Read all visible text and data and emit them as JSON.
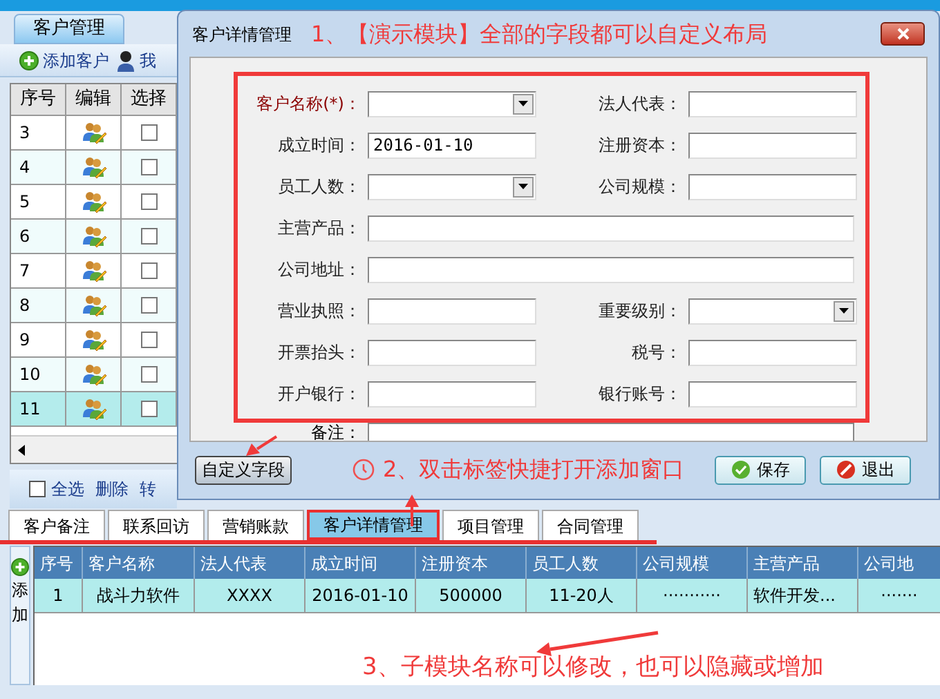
{
  "main_tab": {
    "label": "客户管理",
    "selected": true
  },
  "toolbar": [
    {
      "label": "添加客户",
      "kind": "add"
    },
    {
      "label": "我",
      "kind": "user"
    }
  ],
  "customer_grid": {
    "columns": [
      "序号",
      "编辑",
      "选择"
    ],
    "rows": [
      {
        "index": "3",
        "checked": false,
        "selected": false
      },
      {
        "index": "4",
        "checked": false,
        "selected": false
      },
      {
        "index": "5",
        "checked": false,
        "selected": false
      },
      {
        "index": "6",
        "checked": false,
        "selected": false
      },
      {
        "index": "7",
        "checked": false,
        "selected": false
      },
      {
        "index": "8",
        "checked": false,
        "selected": false
      },
      {
        "index": "9",
        "checked": false,
        "selected": false
      },
      {
        "index": "10",
        "checked": false,
        "selected": false
      },
      {
        "index": "11",
        "checked": false,
        "selected": true
      }
    ]
  },
  "bottom_actions": {
    "select_all": {
      "label": "全选",
      "checked": false
    },
    "links": [
      "删除",
      "转"
    ]
  },
  "dialog": {
    "title": "客户详情管理",
    "title_note": "1、【演示模块】全部的字段都可以自定义布局",
    "rows": [
      [
        {
          "label": "客户名称(*)：",
          "kind": "dropdown",
          "required": true
        },
        {
          "label": "法人代表：",
          "kind": "text",
          "required": false
        }
      ],
      [
        {
          "label": "成立时间：",
          "kind": "text",
          "required": false,
          "value": "2016-01-10"
        },
        {
          "label": "注册资本：",
          "kind": "text",
          "required": false
        }
      ],
      [
        {
          "label": "员工人数：",
          "kind": "dropdown",
          "required": false
        },
        {
          "label": "公司规模：",
          "kind": "text",
          "required": false
        }
      ],
      [
        {
          "label": "主营产品：",
          "kind": "text",
          "required": false
        }
      ],
      [
        {
          "label": "公司地址：",
          "kind": "text",
          "required": false
        }
      ],
      [
        {
          "label": "营业执照：",
          "kind": "text",
          "required": false
        },
        {
          "label": "重要级别：",
          "kind": "dropdown",
          "required": false
        }
      ],
      [
        {
          "label": "开票抬头：",
          "kind": "text",
          "required": false
        },
        {
          "label": "税号：",
          "kind": "text",
          "required": false
        }
      ],
      [
        {
          "label": "开户银行：",
          "kind": "text",
          "required": false
        },
        {
          "label": "银行账号：",
          "kind": "text",
          "required": false
        }
      ]
    ],
    "remark": {
      "label": "备注："
    },
    "custom_fields_button": "自定义字段",
    "footer_note": "2、双击标签快捷打开添加窗口",
    "buttons": [
      {
        "label": "保存",
        "kind": "save"
      },
      {
        "label": "退出",
        "kind": "exit"
      }
    ]
  },
  "sub_tabs": [
    {
      "label": "客户备注",
      "selected": false
    },
    {
      "label": "联系回访",
      "selected": false
    },
    {
      "label": "营销账款",
      "selected": false
    },
    {
      "label": "客户详情管理",
      "selected": true
    },
    {
      "label": "项目管理",
      "selected": false
    },
    {
      "label": "合同管理",
      "selected": false
    }
  ],
  "add_button": "添加",
  "detail_table": {
    "columns": [
      "序号",
      "客户名称",
      "法人代表",
      "成立时间",
      "注册资本",
      "员工人数",
      "公司规模",
      "主营产品",
      "公司地"
    ],
    "rows": [
      [
        "1",
        "战斗力软件",
        "XXXX",
        "2016-01-10",
        "500000",
        "11-20人",
        "···········",
        "软件开发...",
        "·······"
      ]
    ],
    "note": "3、子模块名称可以修改，也可以隐藏或增加"
  }
}
